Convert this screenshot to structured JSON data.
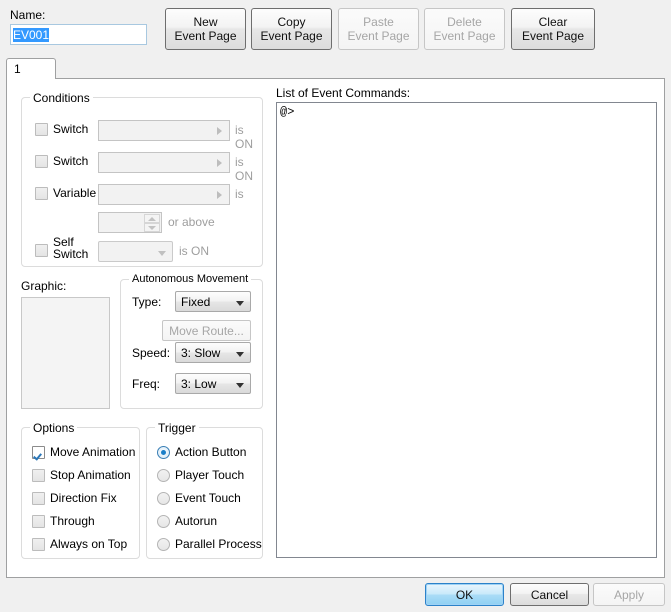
{
  "header": {
    "name_label": "Name:",
    "name_value": "EV001",
    "buttons": [
      {
        "label": "New\nEvent Page",
        "enabled": true
      },
      {
        "label": "Copy\nEvent Page",
        "enabled": true
      },
      {
        "label": "Paste\nEvent Page",
        "enabled": false
      },
      {
        "label": "Delete\nEvent Page",
        "enabled": false
      },
      {
        "label": "Clear\nEvent Page",
        "enabled": true
      }
    ]
  },
  "tabs": [
    {
      "label": "1",
      "selected": true
    }
  ],
  "conditions": {
    "legend": "Conditions",
    "rows": [
      {
        "checkbox_label": "Switch",
        "checked": false,
        "field_value": "",
        "suffix": "is ON"
      },
      {
        "checkbox_label": "Switch",
        "checked": false,
        "field_value": "",
        "suffix": "is ON"
      },
      {
        "checkbox_label": "Variable",
        "checked": false,
        "field_value": "",
        "suffix": "is"
      },
      {
        "checkbox_label": "",
        "checked": false,
        "field_value": "",
        "suffix": "or above"
      },
      {
        "checkbox_label": "Self\nSwitch",
        "checked": false,
        "field_value": "",
        "suffix": "is ON"
      }
    ]
  },
  "graphic": {
    "label": "Graphic:",
    "value": ""
  },
  "autonomous_movement": {
    "legend": "Autonomous Movement",
    "type_label": "Type:",
    "type_value": "Fixed",
    "move_route_label": "Move Route...",
    "move_route_enabled": false,
    "speed_label": "Speed:",
    "speed_value": "3: Slow",
    "freq_label": "Freq:",
    "freq_value": "3: Low"
  },
  "options": {
    "legend": "Options",
    "items": [
      {
        "label": "Move Animation",
        "checked": true
      },
      {
        "label": "Stop Animation",
        "checked": false
      },
      {
        "label": "Direction Fix",
        "checked": false
      },
      {
        "label": "Through",
        "checked": false
      },
      {
        "label": "Always on Top",
        "checked": false
      }
    ]
  },
  "trigger": {
    "legend": "Trigger",
    "items": [
      {
        "label": "Action Button",
        "selected": true
      },
      {
        "label": "Player Touch",
        "selected": false
      },
      {
        "label": "Event Touch",
        "selected": false
      },
      {
        "label": "Autorun",
        "selected": false
      },
      {
        "label": "Parallel Process",
        "selected": false
      }
    ]
  },
  "event_commands": {
    "label": "List of Event Commands:",
    "lines": [
      "@>"
    ]
  },
  "footer": {
    "ok_label": "OK",
    "cancel_label": "Cancel",
    "apply_label": "Apply",
    "apply_enabled": false
  },
  "colors": {
    "accent": "#3399ff",
    "check": "#2b77b8",
    "radio": "#1a7ec8",
    "window_bg": "#f0f0f0",
    "panel_bg": "#ffffff"
  }
}
